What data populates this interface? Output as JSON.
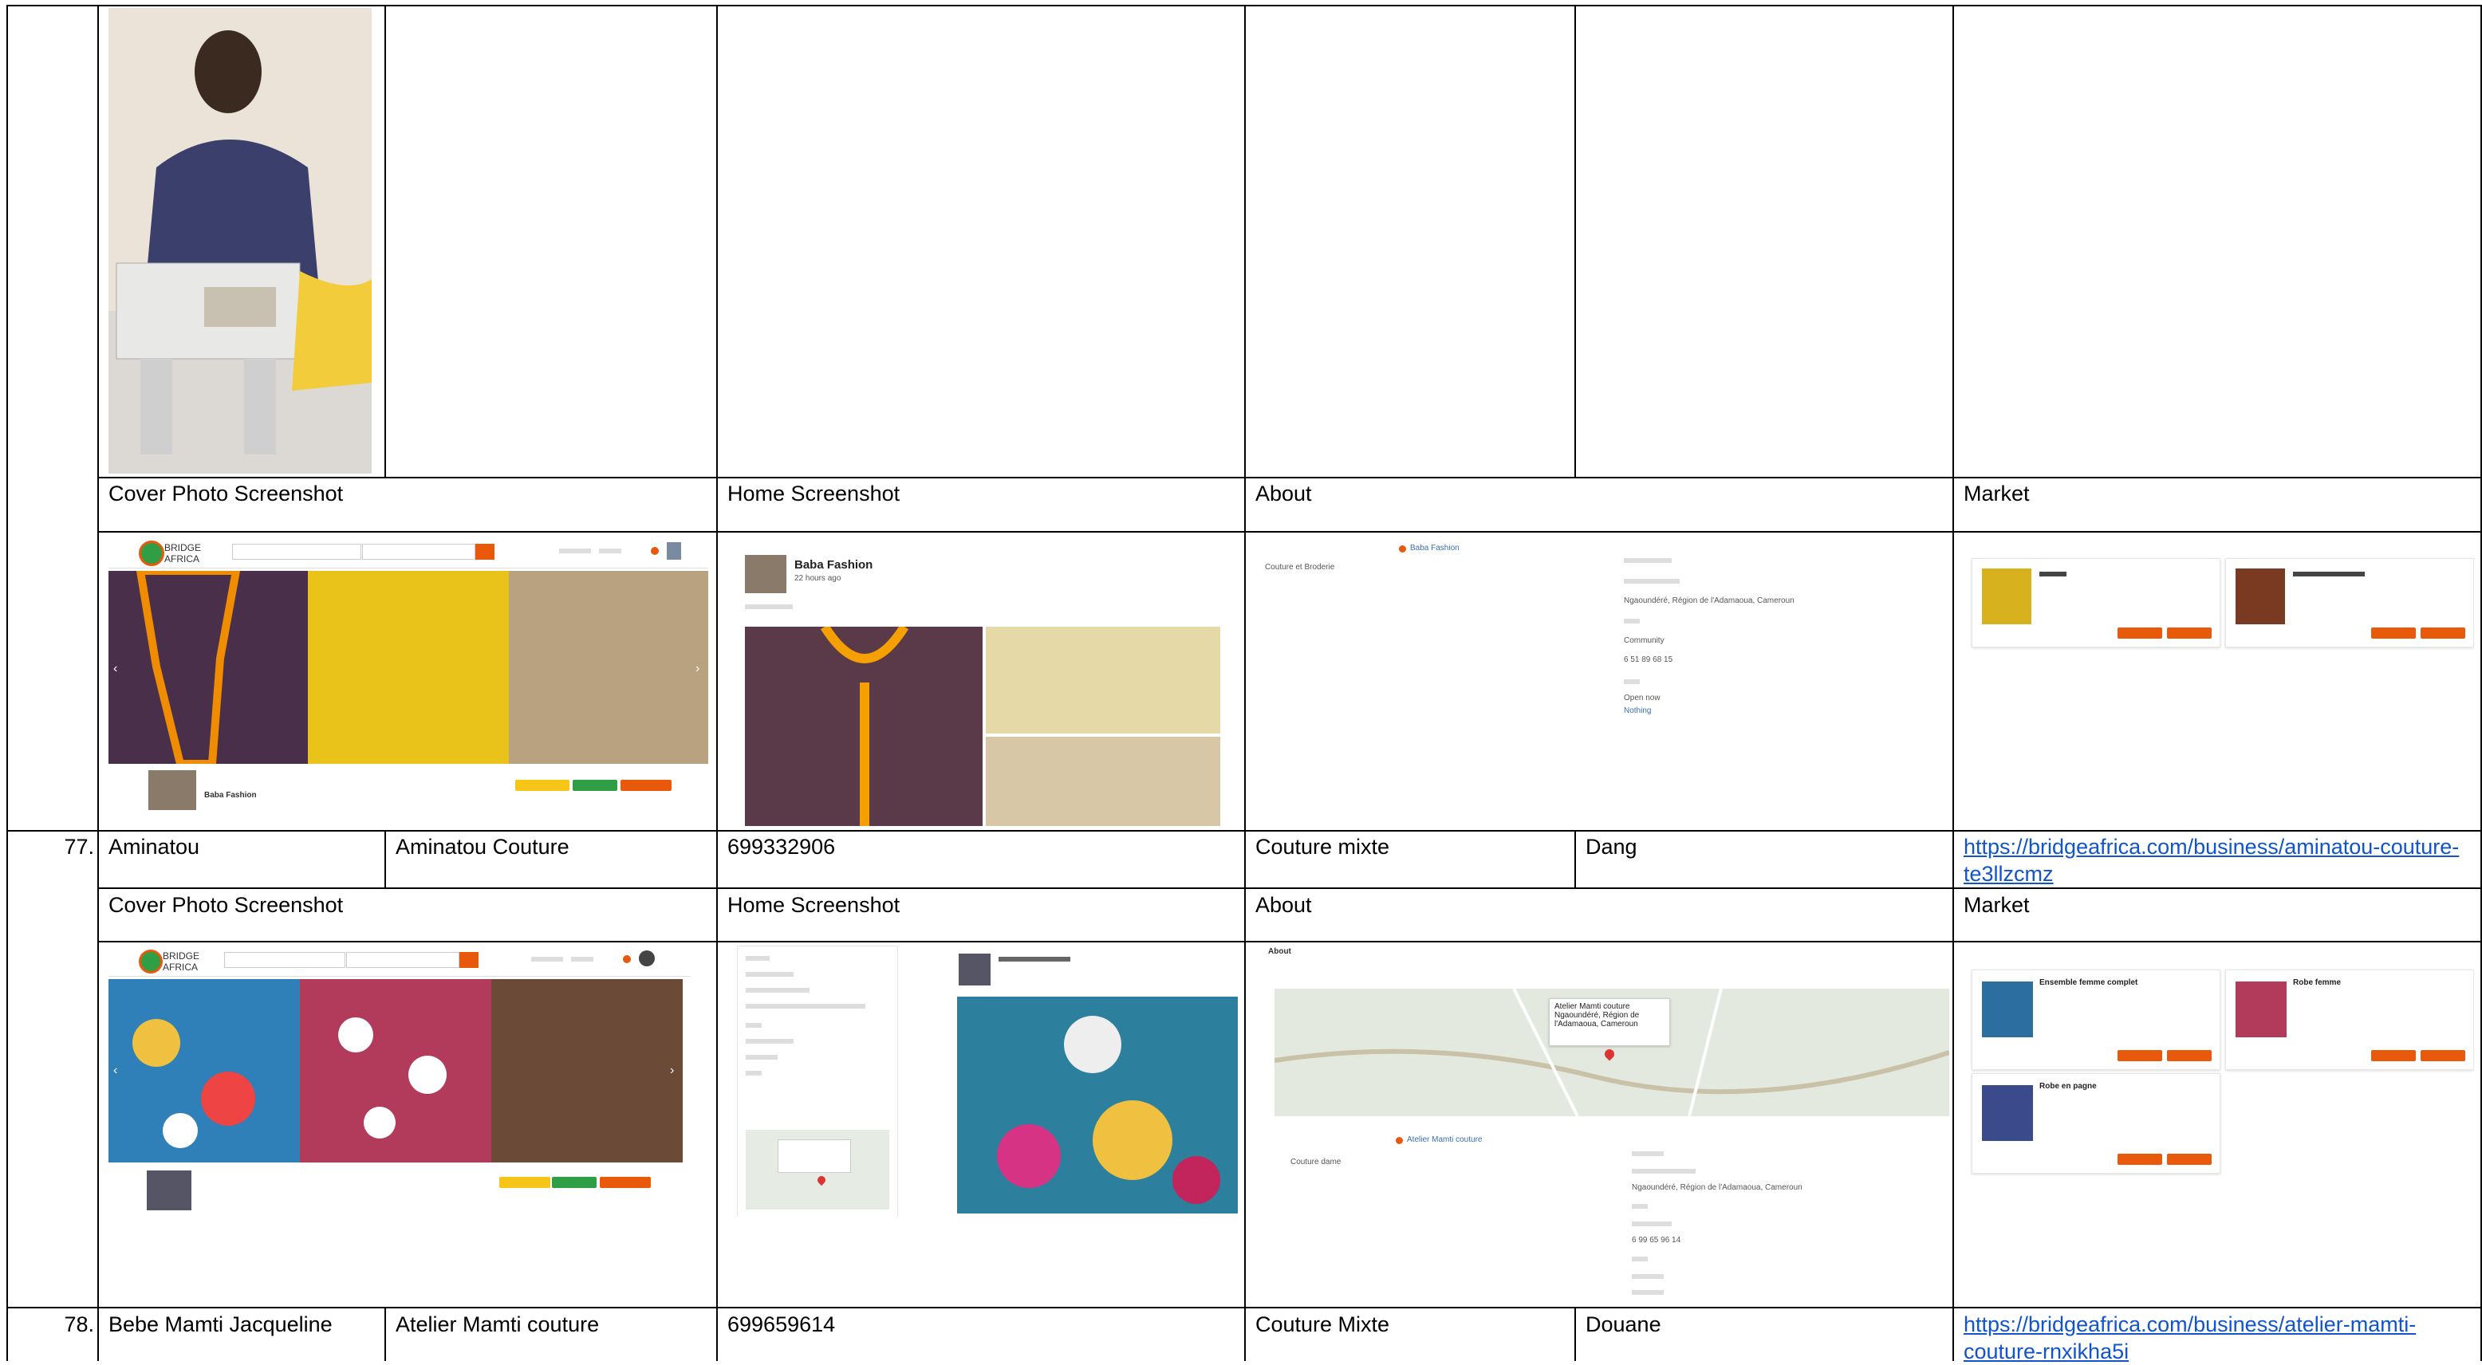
{
  "colors": {
    "brand_orange": "#e8590c",
    "link": "#1155cc",
    "grid": "#000000"
  },
  "headers": {
    "cover": "Cover Photo Screenshot",
    "home": "Home Screenshot",
    "about": "About",
    "market": "Market"
  },
  "rows": [
    {
      "num": "77.",
      "owner": "Aminatou",
      "business": "Aminatou Couture",
      "phone": "699332906",
      "category": "Couture mixte",
      "location": "Dang",
      "url": "https://bridgeafrica.com/business/aminatou-couture-te3llzcmz"
    },
    {
      "num": "78.",
      "owner": "Bebe Mamti Jacqueline",
      "business": "Atelier Mamti couture",
      "phone": "699659614",
      "category": "Couture Mixte",
      "location": "Douane",
      "url": "https://bridgeafrica.com/business/atelier-mamti-couture-rnxikha5i"
    }
  ],
  "screens": {
    "baba": {
      "name": "Baba Fashion",
      "posted": "22 hours ago",
      "about_tag": "Couture et Broderie",
      "address": "Ngaoundéré, Région de l'Adamaoua, Cameroun",
      "community": "Community",
      "phone": "6 51 89 68 15",
      "open": "Open now",
      "nothing": "Nothing"
    },
    "mamti": {
      "about_title": "About",
      "map_popup": "Atelier Mamti couture Ngaoundéré, Région de l'Adamaoua, Cameroun",
      "category": "Atelier Mamti couture",
      "address": "Ngaoundéré, Région de l'Adamaoua, Cameroun",
      "phone": "6 99 65 96 14",
      "about_tag": "Couture dame",
      "product_1": "Ensemble femme complet",
      "product_2": "Robe femme",
      "product_3": "Robe en pagne"
    }
  },
  "icons": [
    "orange-dot-icon",
    "location-pin-icon",
    "phone-icon",
    "clock-icon",
    "search-icon",
    "chevron-left-icon",
    "chevron-right-icon",
    "map-marker-icon"
  ]
}
